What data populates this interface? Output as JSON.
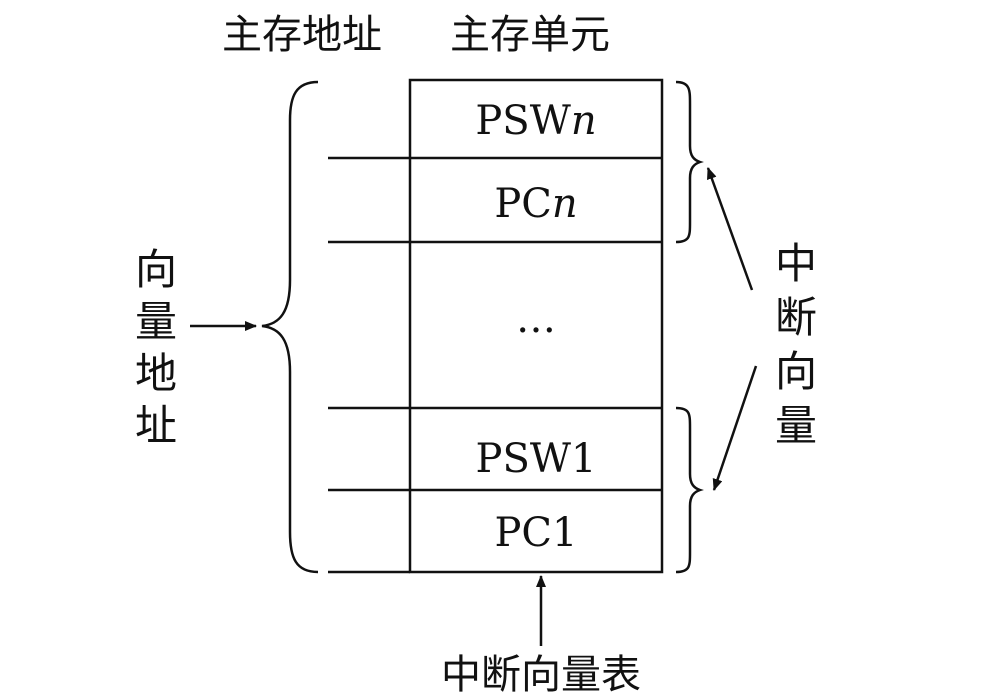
{
  "headers": {
    "address": "主存地址",
    "unit": "主存单元"
  },
  "cells": [
    {
      "main": "PSW",
      "suffix": "n"
    },
    {
      "main": "PC",
      "suffix": "n"
    },
    {
      "main": "…",
      "suffix": ""
    },
    {
      "main": "PSW1",
      "suffix": ""
    },
    {
      "main": "PC1",
      "suffix": ""
    }
  ],
  "left_label": [
    "向",
    "量",
    "地",
    "址"
  ],
  "right_label": [
    "中",
    "断",
    "向",
    "量"
  ],
  "bottom_label": "中断向量表"
}
